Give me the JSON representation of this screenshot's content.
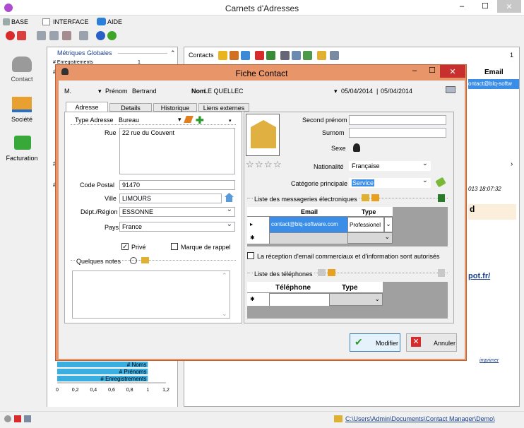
{
  "window": {
    "title": "Carnets d'Adresses",
    "minimize": "–",
    "maximize": "☐",
    "close": "✕"
  },
  "menu": {
    "base": "BASE",
    "interface": "INTERFACE",
    "aide": "AIDE"
  },
  "sidebar": [
    {
      "label": "Contact"
    },
    {
      "label": "Société"
    },
    {
      "label": "Facturation"
    }
  ],
  "metrics": {
    "title": "Métriques Globales",
    "first": "# Enregistrements",
    "first_val": "1",
    "hash": "#"
  },
  "chart_data": {
    "type": "bar",
    "orientation": "horizontal",
    "categories": [
      "# Noms",
      "# Prénoms",
      "# Enregistrements"
    ],
    "values": [
      1,
      1,
      1
    ],
    "xlim": [
      0,
      1.2
    ],
    "xticks": [
      "0",
      "0,2",
      "0,4",
      "0,6",
      "0,8",
      "1",
      "1,2"
    ]
  },
  "contacts_toolbar": {
    "label": "Contacts",
    "count": "1"
  },
  "grid_bg": {
    "email_header": "Email",
    "email_value": "ontact@blq-softw",
    "date_text": "013 18:07:32",
    "link": "pot.fr/",
    "imprimer": "imprimer",
    "letter": "d"
  },
  "statusbar": {
    "path": "C:\\Users\\Admin\\Documents\\Contact Manager\\Demo\\"
  },
  "dialog": {
    "title": "Fiche Contact",
    "civility": "M.",
    "prenom_label": "Prénom",
    "prenom": "Bertrand",
    "nom_label": "Nom",
    "nom": "LE QUELLEC",
    "date1": "05/04/2014",
    "date2": "05/04/2014",
    "tabs": [
      "Adresse",
      "Details",
      "Historique",
      "Liens externes"
    ],
    "type_adresse_label": "Type Adresse",
    "type_adresse": "Bureau",
    "rue_label": "Rue",
    "rue": "22 rue du Couvent",
    "cp_label": "Code Postal",
    "cp": "91470",
    "ville_label": "Ville",
    "ville": "LIMOURS",
    "dept_label": "Dépt./Région",
    "dept": "ESSONNE",
    "pays_label": "Pays",
    "pays": "France",
    "prive": "Privé",
    "rappel": "Marque de rappel",
    "notes_label": "Quelques notes",
    "second_prenom_label": "Second prénom",
    "surnom_label": "Surnom",
    "sexe_label": "Sexe",
    "nationalite_label": "Nationalité",
    "nationalite": "Française",
    "categorie_label": "Catégorie principale",
    "categorie": "Service",
    "messageries_label": "Liste des messageries électroniques",
    "email_col": "Email",
    "type_col": "Type",
    "email_row": "contact@blq-software.com",
    "email_type": "Professionel",
    "consent": "La réception d'email commerciaux et d'information sont autorisés",
    "telephones_label": "Liste des téléphones",
    "tel_col": "Téléphone",
    "tel_type_col": "Type",
    "row_marker": "▸",
    "new_marker": "✱",
    "modifier": "Modifier",
    "annuler": "Annuler"
  }
}
